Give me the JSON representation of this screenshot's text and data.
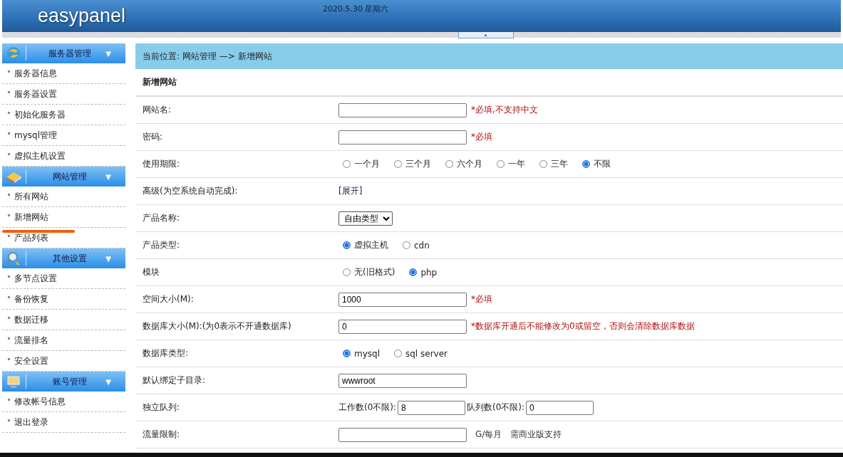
{
  "header": {
    "logo": "easypanel",
    "date": "2020.5.30 星期六",
    "collapse": "▲"
  },
  "sidebar": [
    {
      "title": "服务器管理",
      "toggle": "▼",
      "items": [
        {
          "label": "服务器信息",
          "underlined": false
        },
        {
          "label": "服务器设置",
          "underlined": false
        },
        {
          "label": "初始化服务器",
          "underlined": false
        },
        {
          "label": "mysql管理",
          "underlined": false
        },
        {
          "label": "虚拟主机设置",
          "underlined": false
        }
      ]
    },
    {
      "title": "网站管理",
      "toggle": "▼",
      "items": [
        {
          "label": "所有网站",
          "underlined": false
        },
        {
          "label": "新增网站",
          "underlined": true
        },
        {
          "label": "产品列表",
          "underlined": false
        }
      ]
    },
    {
      "title": "其他设置",
      "toggle": "▼",
      "items": [
        {
          "label": "多节点设置",
          "underlined": false
        },
        {
          "label": "备份恢复",
          "underlined": false
        },
        {
          "label": "数据迁移",
          "underlined": false
        },
        {
          "label": "流量排名",
          "underlined": false
        },
        {
          "label": "安全设置",
          "underlined": false
        }
      ]
    },
    {
      "title": "账号管理",
      "toggle": "▼",
      "items": [
        {
          "label": "修改帐号信息",
          "underlined": false
        },
        {
          "label": "退出登录",
          "underlined": false
        }
      ]
    }
  ],
  "breadcrumb": "当前位置: 网站管理 —> 新增网站",
  "form_title": "新增网站",
  "rows": [
    {
      "kind": "input",
      "label": "网站名:",
      "value": "",
      "notes": [
        {
          "text": "*必填,不支持中文",
          "required": true
        }
      ]
    },
    {
      "kind": "input",
      "label": "密码:",
      "value": "",
      "notes": [
        {
          "text": "*必填",
          "required": true
        }
      ]
    },
    {
      "kind": "radio",
      "label": "使用期限:",
      "options": [
        {
          "label": "一个月",
          "selected": false
        },
        {
          "label": "三个月",
          "selected": false
        },
        {
          "label": "六个月",
          "selected": false
        },
        {
          "label": "一年",
          "selected": false
        },
        {
          "label": "三年",
          "selected": false
        },
        {
          "label": "不限",
          "selected": true
        }
      ]
    },
    {
      "kind": "link",
      "label": "高级(为空系统自动完成):",
      "link": "[展开]"
    },
    {
      "kind": "select",
      "label": "产品名称:",
      "value": "自由类型"
    },
    {
      "kind": "radio",
      "label": "产品类型:",
      "options": [
        {
          "label": "虚拟主机",
          "selected": true
        },
        {
          "label": "cdn",
          "selected": false
        }
      ]
    },
    {
      "kind": "radio",
      "label": "模块",
      "options": [
        {
          "label": "无(旧格式)",
          "selected": false
        },
        {
          "label": "php",
          "selected": true
        }
      ]
    },
    {
      "kind": "input",
      "label": "空间大小(M):",
      "value": "1000",
      "notes": [
        {
          "text": "*必填",
          "required": true
        }
      ]
    },
    {
      "kind": "input",
      "label": "数据库大小(M):(为0表示不开通数据库)",
      "value": "0",
      "notes": [
        {
          "text": "*数据库开通后不能修改为0或留空，否则会清除数据库数据",
          "required": true
        }
      ]
    },
    {
      "kind": "radio",
      "label": "数据库类型:",
      "options": [
        {
          "label": "mysql",
          "selected": true
        },
        {
          "label": "sql server",
          "selected": false
        }
      ]
    },
    {
      "kind": "input",
      "label": "默认绑定子目录:",
      "value": "wwwroot"
    },
    {
      "kind": "pair",
      "label": "独立队列:",
      "fields": [
        {
          "label": "工作数(0不限):",
          "value": "8"
        },
        {
          "label": "队列数(0不限):",
          "value": "0"
        }
      ]
    },
    {
      "kind": "input",
      "label": "流量限制:",
      "value": "",
      "notes": [
        {
          "text": "G/每月",
          "required": false
        },
        {
          "text": "需商业版支持",
          "required": false
        }
      ]
    }
  ]
}
